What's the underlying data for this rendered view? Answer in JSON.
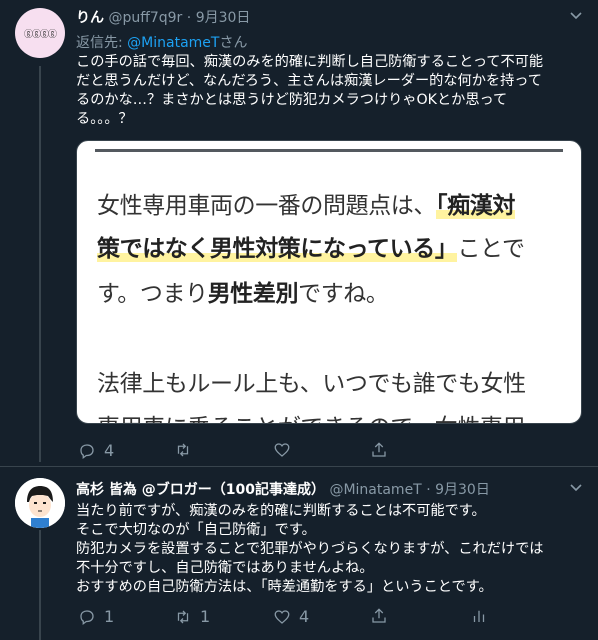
{
  "tweet1": {
    "avatar_text": "ⓖⓖⓖⓖ",
    "name": "りん",
    "handle": "@puff7q9r",
    "sep": "·",
    "date": "9月30日",
    "reply_prefix": "返信先:",
    "reply_link": "@MinatameT",
    "reply_suffix": "さん",
    "lines": [
      "この手の話で毎回、痴漢のみを的確に判断し自己防衛することって不可能",
      "だと思うんだけど、なんだろう、主さんは痴漢レーダー的な何かを持って",
      "るのかな…？まさかとは思うけど防犯カメラつけりゃOKとか思って",
      "る。。。？"
    ],
    "card": {
      "line1_a": "女性専用車両の一番の問題点は、",
      "line1_b": "「痴漢対",
      "line2_a": "策ではなく男性対策になっている」",
      "line2_b": "ことで",
      "line3_a": "す。つまり",
      "line3_b": "男性差別",
      "line3_c": "ですね。",
      "line4": "法律上もルール上も、いつでも誰でも女性",
      "line5": "専用車に乗ることができるので、女性専用"
    },
    "replies": "4",
    "retweets": "",
    "likes": ""
  },
  "tweet2": {
    "name": "高杉 皆為 @ブロガー（100記事達成）",
    "handle": "@MinatameT",
    "sep": "·",
    "date": "9月30日",
    "lines": [
      "当たり前ですが、痴漢のみを的確に判断することは不可能です。",
      "そこで大切なのが「自己防衛」です。",
      "防犯カメラを設置することで犯罪がやりづらくなりますが、これだけでは",
      "不十分ですし、自己防衛ではありませんよね。",
      "おすすめの自己防衛方法は、「時差通勤をする」ということです。"
    ],
    "replies": "1",
    "retweets": "1",
    "likes": "4"
  }
}
